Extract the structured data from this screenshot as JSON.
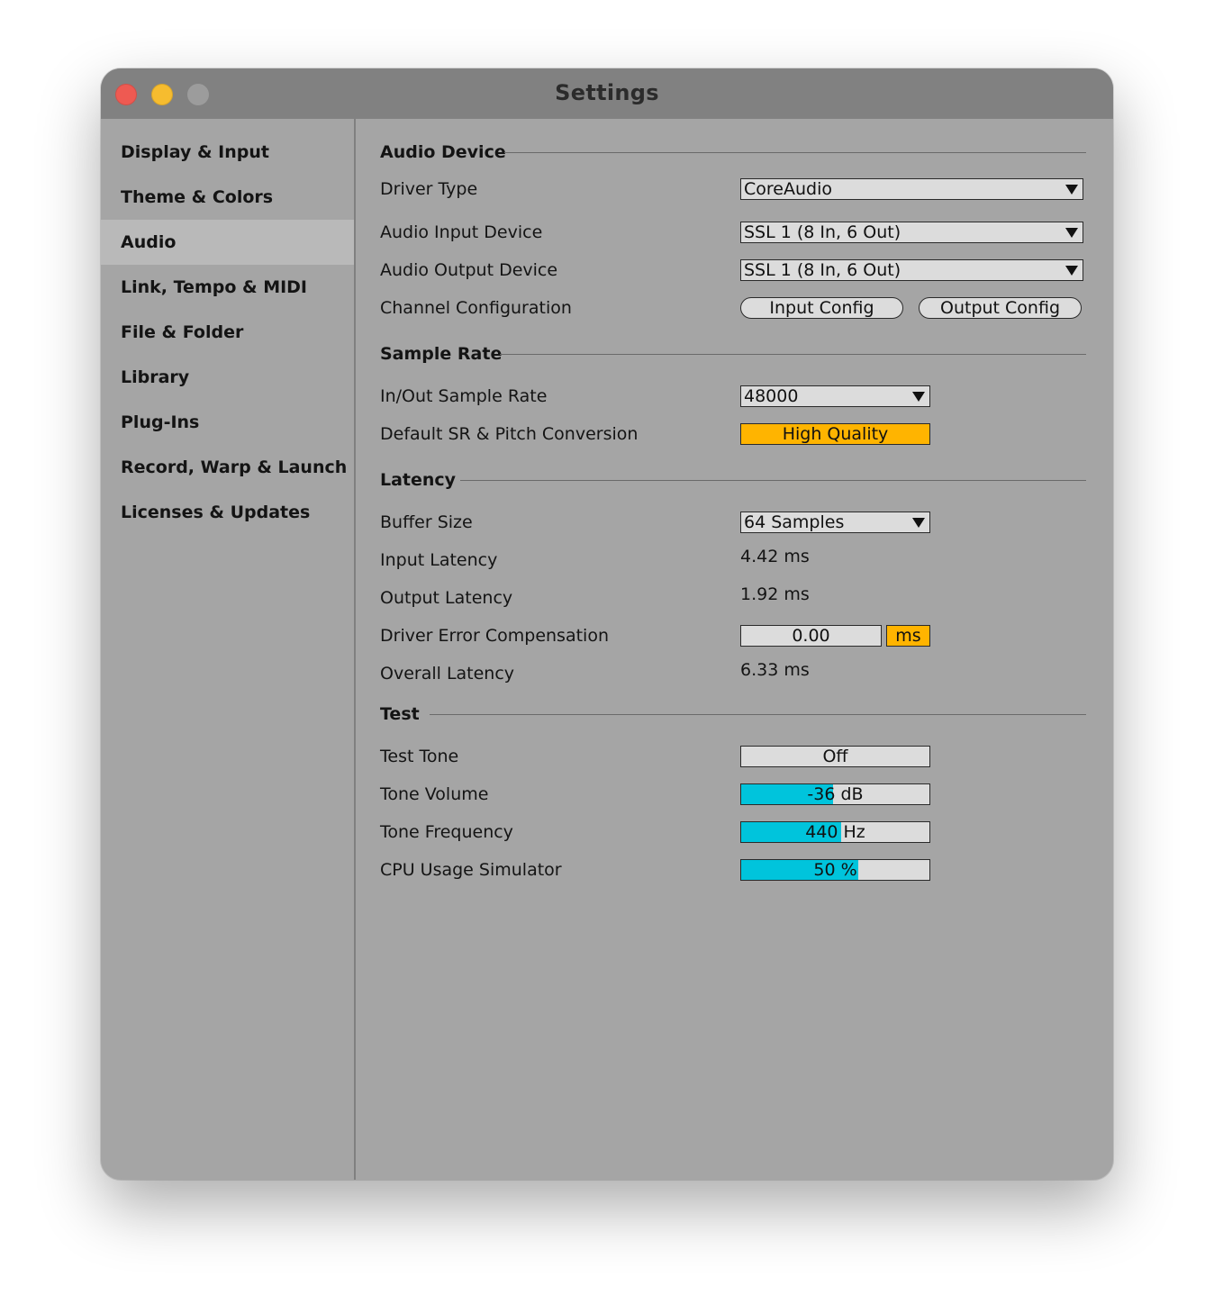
{
  "window": {
    "title": "Settings"
  },
  "sidebar": {
    "items": [
      {
        "label": "Display & Input"
      },
      {
        "label": "Theme & Colors"
      },
      {
        "label": "Audio",
        "active": true
      },
      {
        "label": "Link, Tempo & MIDI"
      },
      {
        "label": "File & Folder"
      },
      {
        "label": "Library"
      },
      {
        "label": "Plug-Ins"
      },
      {
        "label": "Record, Warp & Launch"
      },
      {
        "label": "Licenses & Updates"
      }
    ]
  },
  "audio_device": {
    "title": "Audio Device",
    "driver_type_label": "Driver Type",
    "driver_type_value": "CoreAudio",
    "input_device_label": "Audio Input Device",
    "input_device_value": "SSL 1 (8 In, 6 Out)",
    "output_device_label": "Audio Output Device",
    "output_device_value": "SSL 1 (8 In, 6 Out)",
    "channel_config_label": "Channel Configuration",
    "input_config_button": "Input Config",
    "output_config_button": "Output Config"
  },
  "sample_rate": {
    "title": "Sample Rate",
    "rate_label": "In/Out Sample Rate",
    "rate_value": "48000",
    "conversion_label": "Default SR & Pitch Conversion",
    "conversion_value": "High Quality"
  },
  "latency": {
    "title": "Latency",
    "buffer_label": "Buffer Size",
    "buffer_value": "64 Samples",
    "input_latency_label": "Input Latency",
    "input_latency_value": "4.42 ms",
    "output_latency_label": "Output Latency",
    "output_latency_value": "1.92 ms",
    "driver_error_label": "Driver Error Compensation",
    "driver_error_value": "0.00",
    "driver_error_unit": "ms",
    "overall_label": "Overall Latency",
    "overall_value": "6.33 ms"
  },
  "test": {
    "title": "Test",
    "tone_label": "Test Tone",
    "tone_value": "Off",
    "volume_label": "Tone Volume",
    "volume_value": "-36 dB",
    "volume_fill_fraction": 0.49,
    "frequency_label": "Tone Frequency",
    "frequency_value": "440 Hz",
    "frequency_fill_fraction": 0.53,
    "cpu_label": "CPU Usage Simulator",
    "cpu_value": "50 %",
    "cpu_fill_fraction": 0.62
  },
  "colors": {
    "window_bg": "#a5a5a5",
    "titlebar_bg": "#818181",
    "sidebar_active_bg": "#b9b9b9",
    "accent_orange": "#ffb400",
    "slider_fill": "#00c4dc",
    "control_bg": "#dcdcdc"
  },
  "icons": {
    "close": "close-button-icon",
    "minimize": "minimize-button-icon",
    "maximize": "maximize-button-icon",
    "dropdown": "chevron-down-icon"
  }
}
